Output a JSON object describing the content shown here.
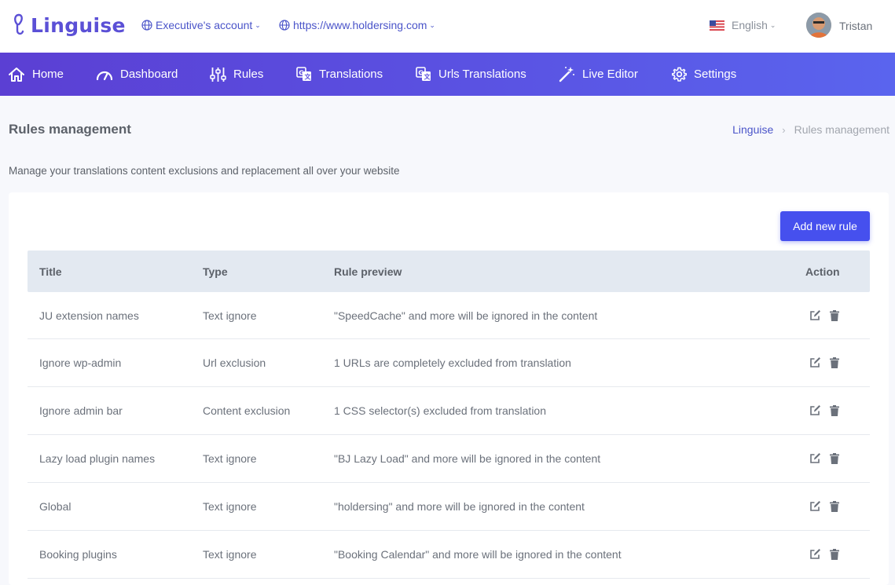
{
  "header": {
    "logo_text": "Linguise",
    "account_label": "Executive's account",
    "site_url": "https://www.holdersing.com",
    "language": "English",
    "user_name": "Tristan",
    "brand_color": "#5b50d6"
  },
  "nav": {
    "items": [
      {
        "label": "Home",
        "icon": "home-icon"
      },
      {
        "label": "Dashboard",
        "icon": "gauge-icon"
      },
      {
        "label": "Rules",
        "icon": "sliders-icon"
      },
      {
        "label": "Translations",
        "icon": "translate-icon"
      },
      {
        "label": "Urls Translations",
        "icon": "translate-icon"
      },
      {
        "label": "Live Editor",
        "icon": "magic-wand-icon"
      },
      {
        "label": "Settings",
        "icon": "gear-icon"
      }
    ],
    "gradient_start": "#5b3fd3",
    "gradient_end": "#5a64ee"
  },
  "page": {
    "title": "Rules management",
    "breadcrumb_root": "Linguise",
    "breadcrumb_current": "Rules management",
    "description": "Manage your translations content exclusions and replacement all over your website",
    "add_button_label": "Add new rule"
  },
  "table": {
    "columns": [
      "Title",
      "Type",
      "Rule preview",
      "Action"
    ],
    "rows": [
      {
        "title": "JU extension names",
        "type": "Text ignore",
        "preview": "\"SpeedCache\" and more will be ignored in the content"
      },
      {
        "title": "Ignore wp-admin",
        "type": "Url exclusion",
        "preview": "1 URLs are completely excluded from translation"
      },
      {
        "title": "Ignore admin bar",
        "type": "Content exclusion",
        "preview": "1 CSS selector(s) excluded from translation"
      },
      {
        "title": "Lazy load plugin names",
        "type": "Text ignore",
        "preview": "\"BJ Lazy Load\" and more will be ignored in the content"
      },
      {
        "title": "Global",
        "type": "Text ignore",
        "preview": "\"holdersing\" and more will be ignored in the content"
      },
      {
        "title": "Booking plugins",
        "type": "Text ignore",
        "preview": "\"Booking Calendar\" and more will be ignored in the content"
      }
    ]
  }
}
